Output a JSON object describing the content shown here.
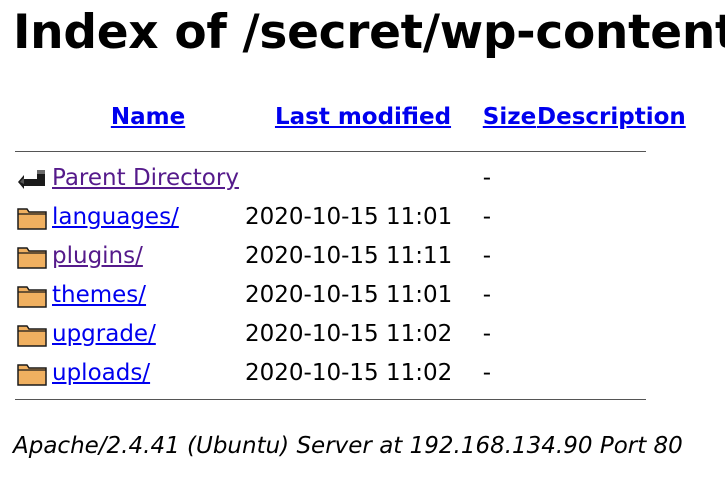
{
  "page": {
    "title": "Index of /secret/wp-content"
  },
  "columns": {
    "name": "Name",
    "last_modified": "Last modified",
    "size": "Size",
    "description": "Description"
  },
  "entries": [
    {
      "name": "Parent Directory",
      "modified": "",
      "size": "-",
      "icon": "back-arrow-icon"
    },
    {
      "name": "languages/",
      "modified": "2020-10-15 11:01",
      "size": "-",
      "icon": "folder-icon"
    },
    {
      "name": "plugins/",
      "modified": "2020-10-15 11:11",
      "size": "-",
      "icon": "folder-icon"
    },
    {
      "name": "themes/",
      "modified": "2020-10-15 11:01",
      "size": "-",
      "icon": "folder-icon"
    },
    {
      "name": "upgrade/",
      "modified": "2020-10-15 11:02",
      "size": "-",
      "icon": "folder-icon"
    },
    {
      "name": "uploads/",
      "modified": "2020-10-15 11:02",
      "size": "-",
      "icon": "folder-icon"
    }
  ],
  "footer": {
    "address": "Apache/2.4.41 (Ubuntu) Server at 192.168.134.90 Port 80"
  },
  "colors": {
    "link": "#0000ee",
    "visited_link": "#551a8b",
    "folder_fill": "#f0b060",
    "rule": "#555555"
  }
}
